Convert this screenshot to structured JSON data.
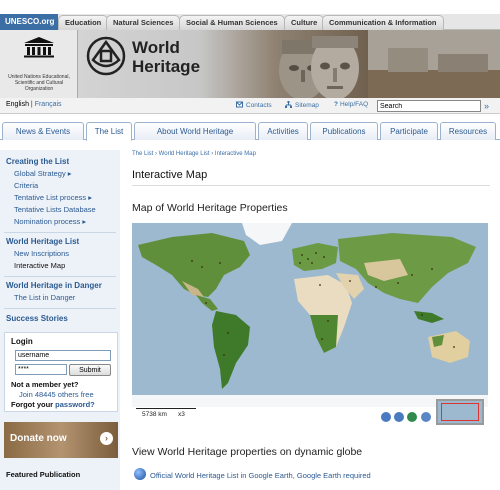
{
  "topbar": {
    "unesco": "UNESCO.org",
    "tabs": [
      "Education",
      "Natural Sciences",
      "Social & Human Sciences",
      "Culture",
      "Communication & Information"
    ]
  },
  "banner": {
    "org_text": "United Nations Educational, Scientific and Cultural Organization",
    "title_line1": "World",
    "title_line2": "Heritage"
  },
  "utility": {
    "lang_en": "English",
    "lang_sep": "|",
    "lang_fr": "Français",
    "contacts": "Contacts",
    "sitemap": "Sitemap",
    "help": "Help/FAQ",
    "search_value": "Search"
  },
  "nav": {
    "tabs": [
      "News & Events",
      "The List",
      "About World Heritage",
      "Activities",
      "Publications",
      "Participate",
      "Resources"
    ],
    "active": "The List"
  },
  "sidebar": {
    "sections": [
      {
        "title": "Creating the List",
        "items": [
          "Global Strategy ▸",
          "Criteria",
          "Tentative List process ▸",
          "Tentative Lists Database",
          "Nomination process ▸"
        ]
      },
      {
        "title": "World Heritage List",
        "items": [
          "New Inscriptions",
          "Interactive Map"
        ]
      },
      {
        "title": "World Heritage in Danger",
        "items": [
          "The List in Danger"
        ]
      },
      {
        "title": "Success Stories",
        "items": []
      }
    ],
    "login": {
      "title": "Login",
      "username_value": "username",
      "password_value": "****",
      "submit": "Submit",
      "not_member": "Not a member yet?",
      "join": "Join 48445 others free",
      "forgot_prefix": "Forgot your",
      "forgot_link": "password?"
    },
    "donate": "Donate now",
    "featured": "Featured Publication"
  },
  "content": {
    "breadcrumb": "The List  ›  World Heritage List  ›  Interactive Map",
    "title": "Interactive Map",
    "map_title": "Map of World Heritage Properties",
    "scale_text": "5738 km",
    "zoom_text": "x3",
    "globe_title": "View World Heritage properties on dynamic globe",
    "ge_link": "Official World Heritage List in Google Earth",
    "ge_sep": ",",
    "ge_req": "Google Earth required"
  },
  "colors": {
    "link": "#2b5a92",
    "ocean": "#9cb9d0",
    "land": "#5f8f3a",
    "desert": "#e9dcc0",
    "ice": "#f4f6f8",
    "sidebar_bg": "#edf2f8"
  }
}
